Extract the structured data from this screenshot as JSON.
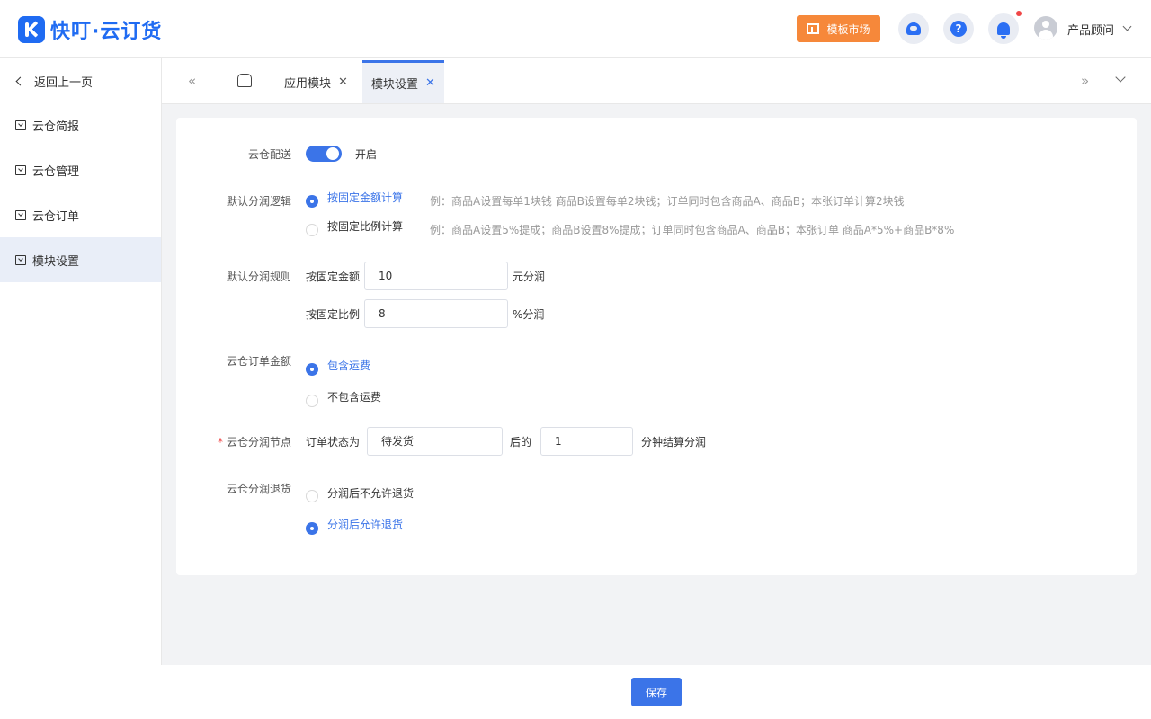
{
  "header": {
    "logo_text": "快叮·云订货",
    "template_market": "模板市场",
    "help_symbol": "?",
    "user_name": "产品顾问"
  },
  "sidebar": {
    "back": "返回上一页",
    "items": [
      "云仓简报",
      "云仓管理",
      "云仓订单",
      "模块设置"
    ],
    "active_index": 3
  },
  "tabs": {
    "items": [
      "应用模块",
      "模块设置"
    ],
    "active": "模块设置"
  },
  "form": {
    "delivery": {
      "label": "云仓配送",
      "state": "开启"
    },
    "logic": {
      "label": "默认分润逻辑",
      "options": [
        {
          "label": "按固定金额计算",
          "hint": "例：商品A设置每单1块钱 商品B设置每单2块钱；订单同时包含商品A、商品B；本张订单计算2块钱",
          "selected": true
        },
        {
          "label": "按固定比例计算",
          "hint": "例：商品A设置5%提成；商品B设置8%提成；订单同时包含商品A、商品B；本张订单 商品A*5%+商品B*8%",
          "selected": false
        }
      ]
    },
    "rule": {
      "label": "默认分润规则",
      "fixed_amount_label": "按固定金额",
      "fixed_amount_value": "10",
      "fixed_amount_unit": "元分润",
      "fixed_ratio_label": "按固定比例",
      "fixed_ratio_value": "8",
      "fixed_ratio_unit": "%分润"
    },
    "order_amount": {
      "label": "云仓订单金额",
      "options": [
        {
          "label": "包含运费",
          "selected": true
        },
        {
          "label": "不包含运费",
          "selected": false
        }
      ]
    },
    "node": {
      "required_mark": "*",
      "label": "云仓分润节点",
      "prefix": "订单状态为",
      "status_value": "待发货",
      "middle": "后的",
      "minutes_value": "1",
      "suffix": "分钟结算分润"
    },
    "return": {
      "label": "云仓分润退货",
      "options": [
        {
          "label": "分润后不允许退货",
          "selected": false
        },
        {
          "label": "分润后允许退货",
          "selected": true
        }
      ]
    }
  },
  "footer": {
    "save": "保存"
  }
}
